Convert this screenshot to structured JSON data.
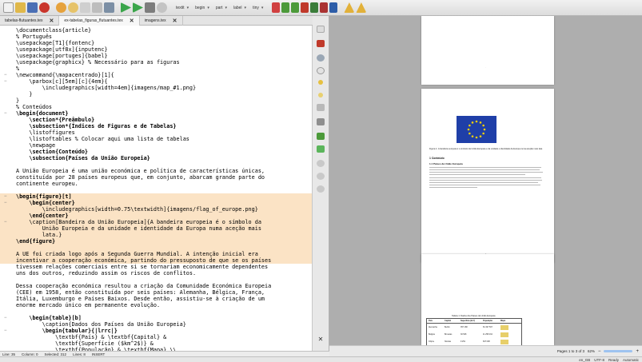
{
  "toolbar": {
    "combo_1": "textit",
    "combo_2": "begin",
    "combo_3": "part",
    "combo_4": "label",
    "combo_5": "tiny"
  },
  "tabs": [
    {
      "label": "tabelas-flutuantes.tex"
    },
    {
      "label": "ex-tabelas_figuras_flutuantes.tex"
    },
    {
      "label": "imagens.tex"
    }
  ],
  "editor": {
    "lines": [
      "\\documentclass{article}",
      "% Português",
      "\\usepackage[T1]{fontenc}",
      "\\usepackage[utf8x]{inputenc}",
      "\\usepackage[portuges]{babel}",
      "\\usepackage{graphicx} % Necessário para as figuras",
      "%",
      "\\newcommand{\\mapacentrado}[1]{",
      "    \\parbox[c][5em][c]{4em}{",
      "        \\includegraphics[width=4em]{imagens/map_#1.png}",
      "    }",
      "}",
      "% Conteúdos",
      "\\begin{document}",
      "    \\section*{Preâmbulo}",
      "    \\subsection*{Índices de Figuras e de Tabelas}",
      "    \\listoffigures",
      "    \\listoftables % Colocar aqui uma lista de tabelas",
      "    \\newpage",
      "    \\section{Conteúdo}",
      "    \\subsection{Países da União Europeia}",
      "",
      "A União Europeia é uma união económica e política de características únicas,",
      "constituída por 28 países europeus que, em conjunto, abarcam grande parte do",
      "continente europeu.",
      "",
      "\\begin{figure}[t]",
      "    \\begin{center}",
      "        \\includegraphics[width=0.75\\textwidth]{imagens/flag_of_europe.png}",
      "    \\end{center}",
      "    \\caption[Bandeira da União Europeia]{A bandeira europeia é o símbolo da",
      "        União Europeia e da unidade e identidade da Europa numa aceção mais",
      "        lata.}",
      "\\end{figure}",
      "",
      "A UE foi criada logo após a Segunda Guerra Mundial. A intenção inicial era",
      "incentivar a cooperação económica, partindo do pressuposto de que se os países",
      "tivessem relações comerciais entre si se tornariam economicamente dependentes",
      "uns dos outros, reduzindo assim os riscos de conflitos.",
      "",
      "Dessa cooperação económica resultou a criação da Comunidade Económica Europeia",
      "(CEE) em 1958, então constituída por seis países: Alemanha, Bélgica, França,",
      "Itália, Luxemburgo e Países Baixos. Desde então, assistiu-se à criação de um",
      "enorme mercado único em permanente evolução.",
      "",
      "    \\begin{table}[b]",
      "        \\caption{Dados dos Países da União Europeia}",
      "        \\begin{tabular}{|lrrc|}",
      "            \\textbf{País} & \\textbf{Capital} &",
      "            \\textbf{Superfície ($km^2$)} &",
      "            \\textbf{População} & \\textbf{Mapa} \\\\"
    ]
  },
  "status": {
    "line": "Line: 35",
    "column": "Column: 0",
    "selected": "Selected: 312",
    "lines": "Lines: 8",
    "mode": "INSERT"
  },
  "preview_page2": {
    "caption": "Figura 1: A bandeira europeia é o símbolo da União Europeia e da unidade e identidade da Europa numa aceção mais lata.",
    "section": "1 Conteúdo",
    "subsection": "1.1 Países da União Europeia"
  },
  "preview_page3": {
    "table_caption": "Tabela 1: Dados dos Países da União Europeia",
    "headers": [
      "País",
      "Capital",
      "Superfície (km²)",
      "População",
      "Mapa"
    ],
    "rows": [
      [
        "Alemanha",
        "Berlim",
        "357 168",
        "81 197 537"
      ],
      [
        "Bélgica",
        "Bruxelas",
        "30 528",
        "11 258 434"
      ],
      [
        "Chipre",
        "Nicósia",
        "9 251",
        "847 008"
      ]
    ]
  },
  "preview_status": {
    "pages": "Pages 1 to 3 of 3",
    "zoom": "62%"
  },
  "bottom_bar": {
    "lang": "en_GB",
    "encoding": "UTF-8",
    "state": "Ready",
    "mode": "Automatic"
  },
  "colors": {
    "highlight": "#fbe3c5",
    "command": "#1e38c0",
    "comment": "#6b8e4e",
    "flag_blue": "#1f3fa8",
    "flag_star": "#f4d000"
  }
}
